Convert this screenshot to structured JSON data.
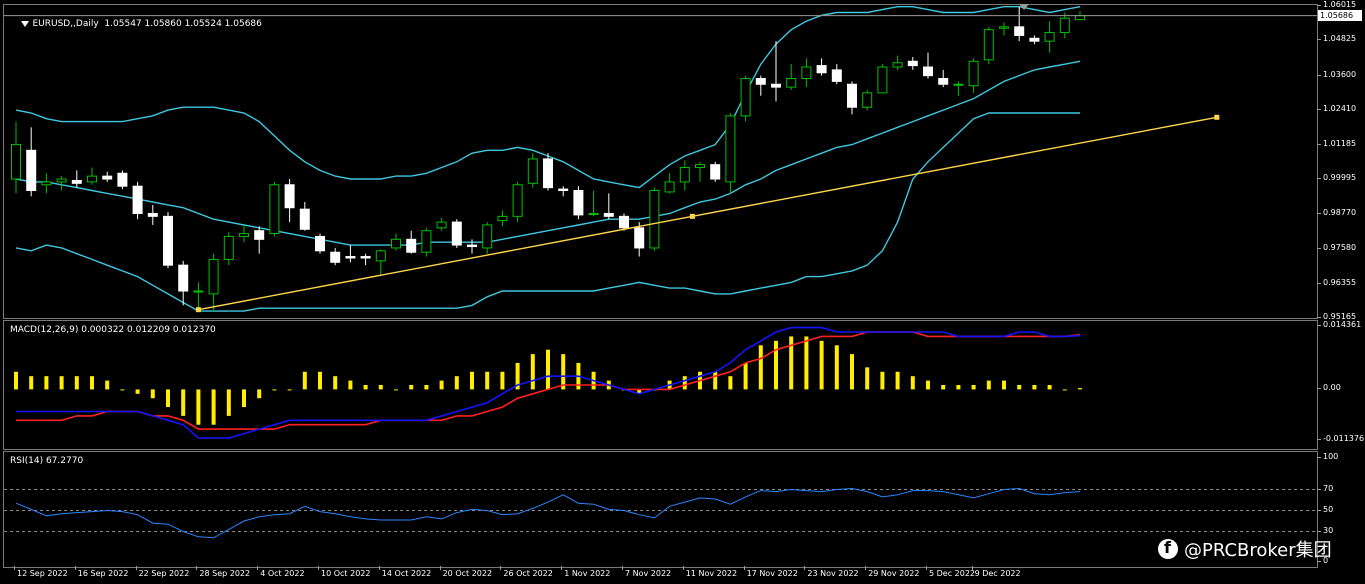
{
  "symbol_header": "EURUSD,,Daily  1.05547 1.05860 1.05524 1.05686",
  "current_price": "1.05686",
  "colors": {
    "bull": "#00c000",
    "bear": "#ffffff",
    "bands": "#3ec7e0",
    "trendline": "#ffd54a",
    "macd_hist": "#ffee00",
    "macd_line": "#1414ff",
    "signal_line": "#ff2020",
    "rsi": "#2e84ff",
    "grid": "#8a8a8a"
  },
  "watermark": "@PRCBroker集团",
  "chart_data": [
    {
      "type": "candlestick",
      "title": "EURUSD,,Daily",
      "ohlc_header": "1.05547 1.05860 1.05524 1.05686",
      "y_ticks": [
        "1.06015",
        "1.04825",
        "1.03600",
        "1.02410",
        "1.01185",
        "0.99995",
        "0.98770",
        "0.97580",
        "0.96355",
        "0.95165"
      ],
      "ylim": [
        0.9516,
        1.0606
      ],
      "overlays": [
        "Bollinger Bands (upper, middle, lower)",
        "Trendline"
      ],
      "candles": [
        {
          "o": 1.0,
          "h": 1.02,
          "l": 0.995,
          "c": 1.012
        },
        {
          "o": 1.01,
          "h": 1.018,
          "l": 0.994,
          "c": 0.996
        },
        {
          "o": 0.998,
          "h": 1.002,
          "l": 0.995,
          "c": 0.999
        },
        {
          "o": 0.999,
          "h": 1.001,
          "l": 0.996,
          "c": 1.0
        },
        {
          "o": 0.9995,
          "h": 1.003,
          "l": 0.997,
          "c": 0.9985
        },
        {
          "o": 0.999,
          "h": 1.004,
          "l": 0.998,
          "c": 1.001
        },
        {
          "o": 1.001,
          "h": 1.0025,
          "l": 0.999,
          "c": 1.0
        },
        {
          "o": 1.002,
          "h": 1.003,
          "l": 0.9965,
          "c": 0.9975
        },
        {
          "o": 0.9975,
          "h": 0.999,
          "l": 0.986,
          "c": 0.988
        },
        {
          "o": 0.988,
          "h": 0.991,
          "l": 0.984,
          "c": 0.987
        },
        {
          "o": 0.987,
          "h": 0.9885,
          "l": 0.969,
          "c": 0.97
        },
        {
          "o": 0.97,
          "h": 0.9715,
          "l": 0.956,
          "c": 0.961
        },
        {
          "o": 0.961,
          "h": 0.964,
          "l": 0.955,
          "c": 0.961
        },
        {
          "o": 0.96,
          "h": 0.974,
          "l": 0.954,
          "c": 0.972
        },
        {
          "o": 0.972,
          "h": 0.9815,
          "l": 0.97,
          "c": 0.98
        },
        {
          "o": 0.98,
          "h": 0.984,
          "l": 0.978,
          "c": 0.981
        },
        {
          "o": 0.982,
          "h": 0.9835,
          "l": 0.974,
          "c": 0.979
        },
        {
          "o": 0.981,
          "h": 0.999,
          "l": 0.98,
          "c": 0.998
        },
        {
          "o": 0.998,
          "h": 1.0,
          "l": 0.985,
          "c": 0.99
        },
        {
          "o": 0.9895,
          "h": 0.992,
          "l": 0.982,
          "c": 0.9825
        },
        {
          "o": 0.98,
          "h": 0.981,
          "l": 0.974,
          "c": 0.975
        },
        {
          "o": 0.9745,
          "h": 0.976,
          "l": 0.97,
          "c": 0.971
        },
        {
          "o": 0.973,
          "h": 0.977,
          "l": 0.971,
          "c": 0.9725
        },
        {
          "o": 0.973,
          "h": 0.974,
          "l": 0.97,
          "c": 0.9725
        },
        {
          "o": 0.9715,
          "h": 0.9755,
          "l": 0.9665,
          "c": 0.975
        },
        {
          "o": 0.976,
          "h": 0.981,
          "l": 0.975,
          "c": 0.979
        },
        {
          "o": 0.979,
          "h": 0.982,
          "l": 0.974,
          "c": 0.9745
        },
        {
          "o": 0.9745,
          "h": 0.983,
          "l": 0.973,
          "c": 0.982
        },
        {
          "o": 0.983,
          "h": 0.9865,
          "l": 0.982,
          "c": 0.985
        },
        {
          "o": 0.985,
          "h": 0.986,
          "l": 0.976,
          "c": 0.977
        },
        {
          "o": 0.977,
          "h": 0.979,
          "l": 0.974,
          "c": 0.9765
        },
        {
          "o": 0.976,
          "h": 0.985,
          "l": 0.974,
          "c": 0.984
        },
        {
          "o": 0.9855,
          "h": 0.989,
          "l": 0.9835,
          "c": 0.987
        },
        {
          "o": 0.987,
          "h": 0.999,
          "l": 0.985,
          "c": 0.998
        },
        {
          "o": 0.9985,
          "h": 1.009,
          "l": 0.997,
          "c": 1.007
        },
        {
          "o": 1.007,
          "h": 1.009,
          "l": 0.996,
          "c": 0.997
        },
        {
          "o": 0.9965,
          "h": 0.9975,
          "l": 0.994,
          "c": 0.996
        },
        {
          "o": 0.996,
          "h": 0.9975,
          "l": 0.986,
          "c": 0.9875
        },
        {
          "o": 0.988,
          "h": 0.996,
          "l": 0.987,
          "c": 0.988
        },
        {
          "o": 0.988,
          "h": 0.995,
          "l": 0.986,
          "c": 0.987
        },
        {
          "o": 0.987,
          "h": 0.988,
          "l": 0.982,
          "c": 0.983
        },
        {
          "o": 0.983,
          "h": 0.985,
          "l": 0.973,
          "c": 0.976
        },
        {
          "o": 0.976,
          "h": 0.997,
          "l": 0.975,
          "c": 0.996
        },
        {
          "o": 0.9955,
          "h": 1.002,
          "l": 0.995,
          "c": 0.999
        },
        {
          "o": 0.999,
          "h": 1.0065,
          "l": 0.996,
          "c": 1.004
        },
        {
          "o": 1.004,
          "h": 1.006,
          "l": 0.999,
          "c": 1.005
        },
        {
          "o": 1.005,
          "h": 1.006,
          "l": 0.999,
          "c": 1.0
        },
        {
          "o": 0.999,
          "h": 1.023,
          "l": 0.995,
          "c": 1.022
        },
        {
          "o": 1.022,
          "h": 1.036,
          "l": 1.02,
          "c": 1.035
        },
        {
          "o": 1.035,
          "h": 1.036,
          "l": 1.029,
          "c": 1.033
        },
        {
          "o": 1.033,
          "h": 1.048,
          "l": 1.027,
          "c": 1.032
        },
        {
          "o": 1.032,
          "h": 1.04,
          "l": 1.031,
          "c": 1.035
        },
        {
          "o": 1.035,
          "h": 1.042,
          "l": 1.032,
          "c": 1.039
        },
        {
          "o": 1.0395,
          "h": 1.042,
          "l": 1.036,
          "c": 1.037
        },
        {
          "o": 1.038,
          "h": 1.04,
          "l": 1.033,
          "c": 1.034
        },
        {
          "o": 1.033,
          "h": 1.034,
          "l": 1.0225,
          "c": 1.025
        },
        {
          "o": 1.025,
          "h": 1.031,
          "l": 1.024,
          "c": 1.03
        },
        {
          "o": 1.03,
          "h": 1.04,
          "l": 1.03,
          "c": 1.039
        },
        {
          "o": 1.039,
          "h": 1.043,
          "l": 1.038,
          "c": 1.0405
        },
        {
          "o": 1.041,
          "h": 1.0425,
          "l": 1.038,
          "c": 1.0395
        },
        {
          "o": 1.039,
          "h": 1.044,
          "l": 1.035,
          "c": 1.036
        },
        {
          "o": 1.035,
          "h": 1.038,
          "l": 1.032,
          "c": 1.033
        },
        {
          "o": 1.033,
          "h": 1.034,
          "l": 1.029,
          "c": 1.033
        },
        {
          "o": 1.0325,
          "h": 1.042,
          "l": 1.03,
          "c": 1.041
        },
        {
          "o": 1.0415,
          "h": 1.053,
          "l": 1.04,
          "c": 1.052
        },
        {
          "o": 1.0525,
          "h": 1.0545,
          "l": 1.05,
          "c": 1.053
        },
        {
          "o": 1.053,
          "h": 1.06,
          "l": 1.048,
          "c": 1.05
        },
        {
          "o": 1.049,
          "h": 1.05,
          "l": 1.047,
          "c": 1.048
        },
        {
          "o": 1.048,
          "h": 1.055,
          "l": 1.044,
          "c": 1.051
        },
        {
          "o": 1.051,
          "h": 1.058,
          "l": 1.049,
          "c": 1.056
        },
        {
          "o": 1.0555,
          "h": 1.0586,
          "l": 1.0552,
          "c": 1.0569
        }
      ],
      "bands": {
        "upper": [
          1.024,
          1.023,
          1.021,
          1.02,
          1.02,
          1.02,
          1.02,
          1.02,
          1.021,
          1.022,
          1.024,
          1.025,
          1.025,
          1.025,
          1.024,
          1.023,
          1.02,
          1.015,
          1.01,
          1.006,
          1.003,
          1.001,
          1.0,
          1.0,
          1.0,
          1.001,
          1.001,
          1.002,
          1.004,
          1.006,
          1.009,
          1.01,
          1.01,
          1.011,
          1.01,
          1.008,
          1.006,
          1.003,
          1.0,
          0.999,
          0.998,
          0.997,
          1.001,
          1.005,
          1.008,
          1.01,
          1.012,
          1.019,
          1.03,
          1.04,
          1.047,
          1.052,
          1.055,
          1.057,
          1.058,
          1.058,
          1.058,
          1.059,
          1.06,
          1.06,
          1.059,
          1.058,
          1.058,
          1.058,
          1.059,
          1.06,
          1.06,
          1.059,
          1.058,
          1.059,
          1.06
        ],
        "middle": [
          1.0,
          0.999,
          0.999,
          0.998,
          0.997,
          0.996,
          0.995,
          0.994,
          0.993,
          0.992,
          0.991,
          0.99,
          0.988,
          0.986,
          0.985,
          0.984,
          0.983,
          0.982,
          0.981,
          0.98,
          0.979,
          0.978,
          0.977,
          0.977,
          0.977,
          0.977,
          0.977,
          0.978,
          0.978,
          0.978,
          0.978,
          0.978,
          0.979,
          0.98,
          0.981,
          0.982,
          0.983,
          0.984,
          0.985,
          0.986,
          0.986,
          0.986,
          0.987,
          0.988,
          0.99,
          0.992,
          0.993,
          0.995,
          0.998,
          1.0,
          1.003,
          1.005,
          1.007,
          1.009,
          1.011,
          1.012,
          1.014,
          1.016,
          1.018,
          1.02,
          1.022,
          1.024,
          1.026,
          1.028,
          1.031,
          1.034,
          1.036,
          1.038,
          1.039,
          1.04,
          1.041
        ],
        "lower": [
          0.976,
          0.975,
          0.977,
          0.976,
          0.974,
          0.972,
          0.97,
          0.968,
          0.966,
          0.963,
          0.96,
          0.957,
          0.954,
          0.954,
          0.954,
          0.954,
          0.955,
          0.955,
          0.955,
          0.955,
          0.955,
          0.955,
          0.955,
          0.955,
          0.955,
          0.955,
          0.955,
          0.955,
          0.955,
          0.955,
          0.956,
          0.959,
          0.961,
          0.961,
          0.961,
          0.961,
          0.961,
          0.961,
          0.961,
          0.962,
          0.963,
          0.964,
          0.963,
          0.962,
          0.962,
          0.961,
          0.96,
          0.96,
          0.961,
          0.962,
          0.963,
          0.964,
          0.966,
          0.966,
          0.967,
          0.968,
          0.97,
          0.975,
          0.985,
          1.0,
          1.006,
          1.011,
          1.016,
          1.021,
          1.023,
          1.023,
          1.023,
          1.023,
          1.023,
          1.023,
          1.023
        ]
      },
      "trendline": {
        "from": {
          "i": 12,
          "y": 0.9545
        },
        "to": {
          "i": 79,
          "y": 1.0215
        }
      }
    },
    {
      "type": "bar+line",
      "title": "MACD(12,26,9) 0.000322 0.012209 0.012370",
      "y_ticks": [
        "0.014361",
        "0.00",
        "-0.011376"
      ],
      "ylim": [
        -0.0135,
        0.0155
      ],
      "histogram": [
        0.004,
        0.003,
        0.003,
        0.003,
        0.003,
        0.003,
        0.002,
        0.0,
        -0.001,
        -0.002,
        -0.004,
        -0.006,
        -0.008,
        -0.008,
        -0.006,
        -0.004,
        -0.002,
        0.0,
        0.0,
        0.004,
        0.004,
        0.003,
        0.002,
        0.001,
        0.001,
        0.0,
        0.001,
        0.001,
        0.002,
        0.003,
        0.004,
        0.004,
        0.004,
        0.006,
        0.008,
        0.009,
        0.008,
        0.006,
        0.004,
        0.002,
        0.0,
        -0.001,
        0.0,
        0.002,
        0.003,
        0.004,
        0.004,
        0.003,
        0.006,
        0.01,
        0.011,
        0.012,
        0.012,
        0.011,
        0.01,
        0.008,
        0.005,
        0.004,
        0.004,
        0.003,
        0.002,
        0.001,
        0.001,
        0.001,
        0.002,
        0.002,
        0.001,
        0.001,
        0.001,
        0.0,
        0.0003
      ],
      "macd_line": [
        -0.005,
        -0.005,
        -0.005,
        -0.005,
        -0.005,
        -0.005,
        -0.005,
        -0.005,
        -0.005,
        -0.006,
        -0.007,
        -0.008,
        -0.011,
        -0.011,
        -0.011,
        -0.01,
        -0.009,
        -0.008,
        -0.007,
        -0.007,
        -0.007,
        -0.007,
        -0.007,
        -0.007,
        -0.007,
        -0.007,
        -0.007,
        -0.007,
        -0.006,
        -0.005,
        -0.004,
        -0.003,
        -0.001,
        0.001,
        0.002,
        0.003,
        0.003,
        0.003,
        0.002,
        0.001,
        0.0,
        -0.001,
        0.0,
        0.001,
        0.002,
        0.003,
        0.004,
        0.006,
        0.009,
        0.011,
        0.013,
        0.014,
        0.014,
        0.014,
        0.013,
        0.013,
        0.013,
        0.013,
        0.013,
        0.013,
        0.013,
        0.013,
        0.012,
        0.012,
        0.012,
        0.012,
        0.013,
        0.013,
        0.012,
        0.012,
        0.0122
      ],
      "signal_line": [
        -0.007,
        -0.007,
        -0.007,
        -0.007,
        -0.006,
        -0.006,
        -0.005,
        -0.005,
        -0.005,
        -0.006,
        -0.006,
        -0.007,
        -0.009,
        -0.009,
        -0.009,
        -0.009,
        -0.009,
        -0.009,
        -0.008,
        -0.008,
        -0.008,
        -0.008,
        -0.008,
        -0.008,
        -0.007,
        -0.007,
        -0.007,
        -0.007,
        -0.007,
        -0.006,
        -0.006,
        -0.005,
        -0.004,
        -0.002,
        -0.001,
        0.0,
        0.001,
        0.001,
        0.001,
        0.001,
        0.0,
        0.0,
        0.0,
        0.0,
        0.001,
        0.002,
        0.003,
        0.004,
        0.006,
        0.007,
        0.009,
        0.01,
        0.011,
        0.012,
        0.012,
        0.012,
        0.013,
        0.013,
        0.013,
        0.013,
        0.012,
        0.012,
        0.012,
        0.012,
        0.012,
        0.012,
        0.012,
        0.012,
        0.012,
        0.012,
        0.0124
      ]
    },
    {
      "type": "line",
      "title": "RSI(14) 67.2770",
      "y_ticks": [
        "100",
        "70",
        "50",
        "30",
        "0"
      ],
      "ylim": [
        0,
        100
      ],
      "levels": [
        70,
        50,
        30
      ],
      "values": [
        57,
        51,
        45,
        47,
        48,
        49,
        50,
        49,
        46,
        38,
        37,
        30,
        25,
        24,
        32,
        40,
        44,
        46,
        47,
        54,
        49,
        47,
        44,
        42,
        41,
        41,
        41,
        44,
        42,
        48,
        51,
        50,
        46,
        47,
        52,
        58,
        65,
        57,
        56,
        51,
        50,
        46,
        43,
        54,
        58,
        62,
        61,
        56,
        63,
        69,
        68,
        70,
        69,
        68,
        70,
        71,
        68,
        63,
        65,
        69,
        69,
        68,
        65,
        62,
        66,
        70,
        71,
        66,
        65,
        67,
        68
      ],
      "x_labels": [
        "12 Sep 2022",
        "16 Sep 2022",
        "22 Sep 2022",
        "28 Sep 2022",
        "4 Oct 2022",
        "10 Oct 2022",
        "14 Oct 2022",
        "20 Oct 2022",
        "26 Oct 2022",
        "1 Nov 2022",
        "7 Nov 2022",
        "11 Nov 2022",
        "17 Nov 2022",
        "23 Nov 2022",
        "29 Nov 2022",
        "5 Dec 2022",
        "9 Dec 2022"
      ]
    }
  ]
}
